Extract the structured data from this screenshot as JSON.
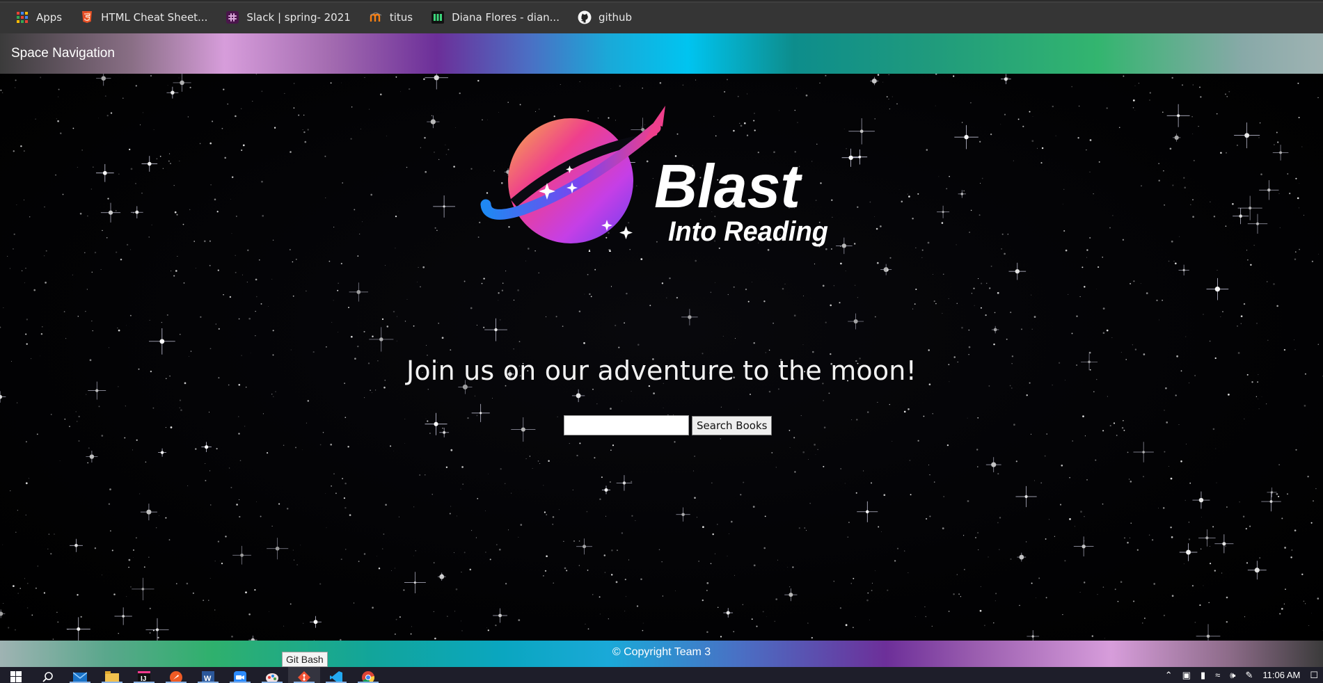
{
  "bookmarks": [
    {
      "label": "Apps",
      "icon": "apps-grid-icon"
    },
    {
      "label": "HTML Cheat Sheet...",
      "icon": "html5-shield-icon"
    },
    {
      "label": "Slack | spring- 2021",
      "icon": "slack-icon"
    },
    {
      "label": "titus",
      "icon": "moodle-icon"
    },
    {
      "label": "Diana Flores - dian...",
      "icon": "handshake-icon"
    },
    {
      "label": "github",
      "icon": "github-octocat-icon"
    }
  ],
  "navbar": {
    "title": "Space Navigation"
  },
  "logo": {
    "title": "Blast",
    "subtitle": "Into Reading"
  },
  "hero": {
    "headline": "Join us on our adventure to the moon!"
  },
  "search": {
    "value": "",
    "button_label": "Search Books"
  },
  "footer": {
    "text": "© Copyright Team 3"
  },
  "tooltip": {
    "text": "Git Bash"
  },
  "taskbar": {
    "apps": [
      {
        "name": "windows-start-icon",
        "state": "normal"
      },
      {
        "name": "search-icon",
        "state": "normal"
      },
      {
        "name": "mail-icon",
        "state": "open"
      },
      {
        "name": "file-explorer-icon",
        "state": "open"
      },
      {
        "name": "intellij-icon",
        "state": "open"
      },
      {
        "name": "postman-icon",
        "state": "open"
      },
      {
        "name": "word-icon",
        "state": "open"
      },
      {
        "name": "zoom-icon",
        "state": "open"
      },
      {
        "name": "paint-icon",
        "state": "open"
      },
      {
        "name": "git-bash-icon",
        "state": "active"
      },
      {
        "name": "vscode-icon",
        "state": "open"
      },
      {
        "name": "chrome-icon",
        "state": "open"
      }
    ],
    "clock": "11:06 AM"
  },
  "colors": {
    "navbar_gradient": [
      "#3b3b3b",
      "#d79ddb",
      "#6c2f99",
      "#00c4f0",
      "#33b56f",
      "#9fb3b3"
    ],
    "logo_planet": [
      "#f6a94e",
      "#ef3d8e",
      "#c43fe8",
      "#7b3ff0"
    ],
    "logo_ring": "#2f8ff0",
    "background": "#030306"
  }
}
